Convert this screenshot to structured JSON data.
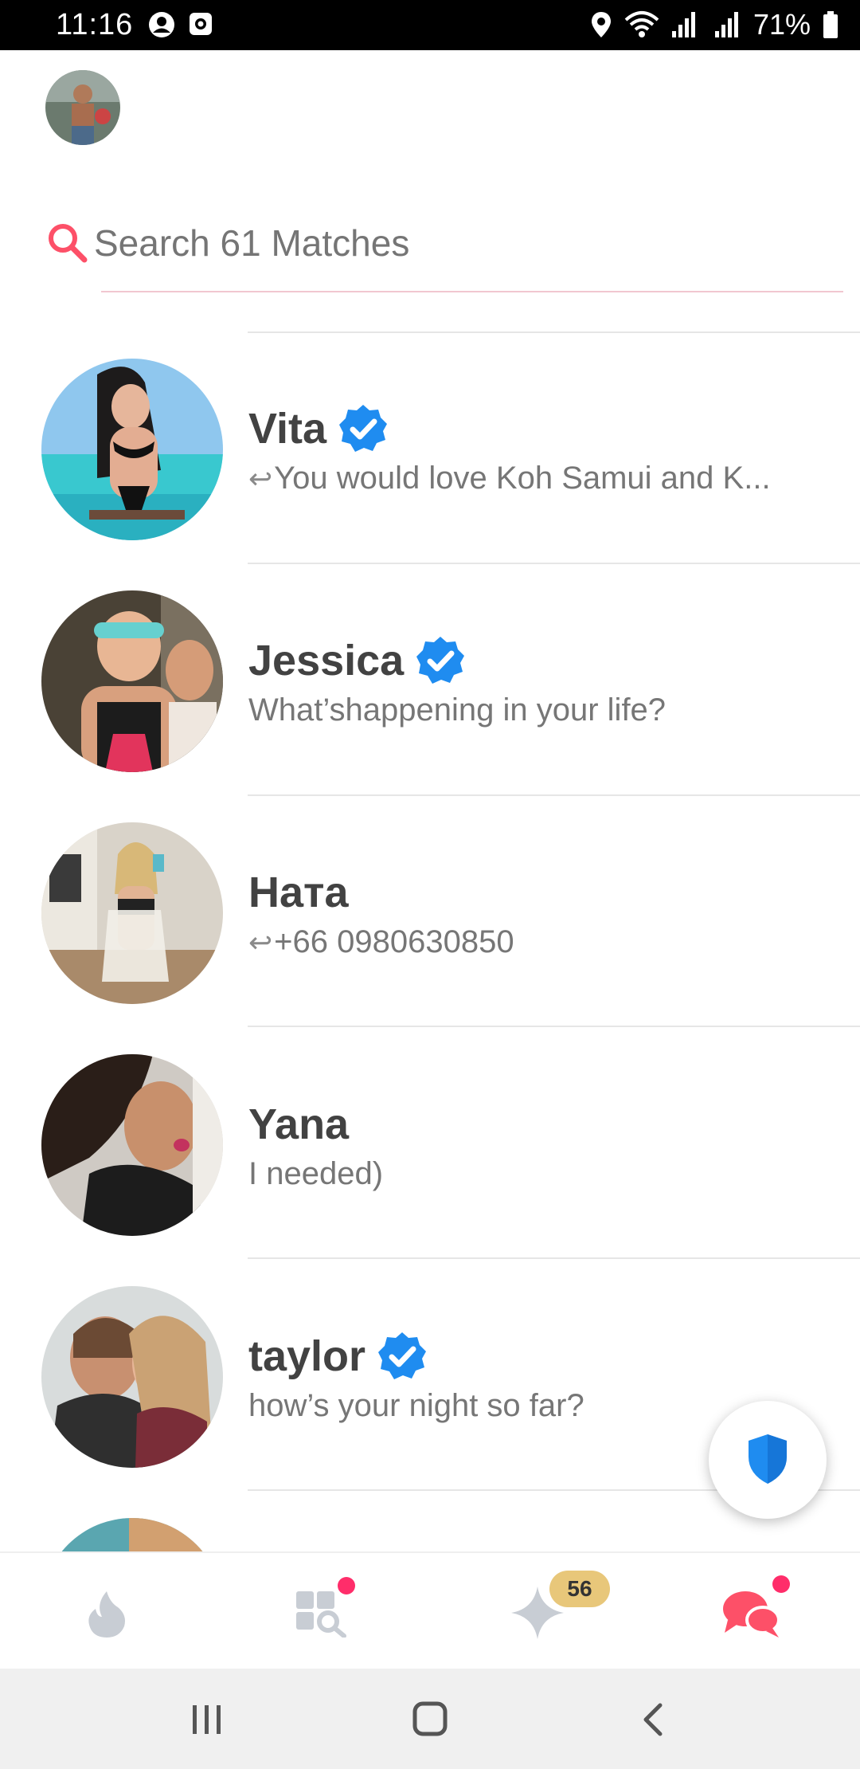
{
  "status_bar": {
    "time": "11:16",
    "battery": "71%"
  },
  "search": {
    "placeholder": "Search 61 Matches"
  },
  "matches": [
    {
      "name": "Vita",
      "verified": true,
      "replied": true,
      "message": "You would love Koh Samui and K..."
    },
    {
      "name": "Jessica",
      "verified": true,
      "replied": false,
      "message": "What’shappening in your life?"
    },
    {
      "name": "Ната",
      "verified": false,
      "replied": true,
      "message": "+66 0980630850"
    },
    {
      "name": "Yana",
      "verified": false,
      "replied": false,
      "message": "I needed)"
    },
    {
      "name": "taylor",
      "verified": true,
      "replied": false,
      "message": "how’s your night so far?"
    }
  ],
  "tabs": {
    "likes_count": "56"
  },
  "colors": {
    "accent": "#fd5068",
    "verified_blue": "#1f8cf0",
    "gold": "#e8c77a"
  }
}
